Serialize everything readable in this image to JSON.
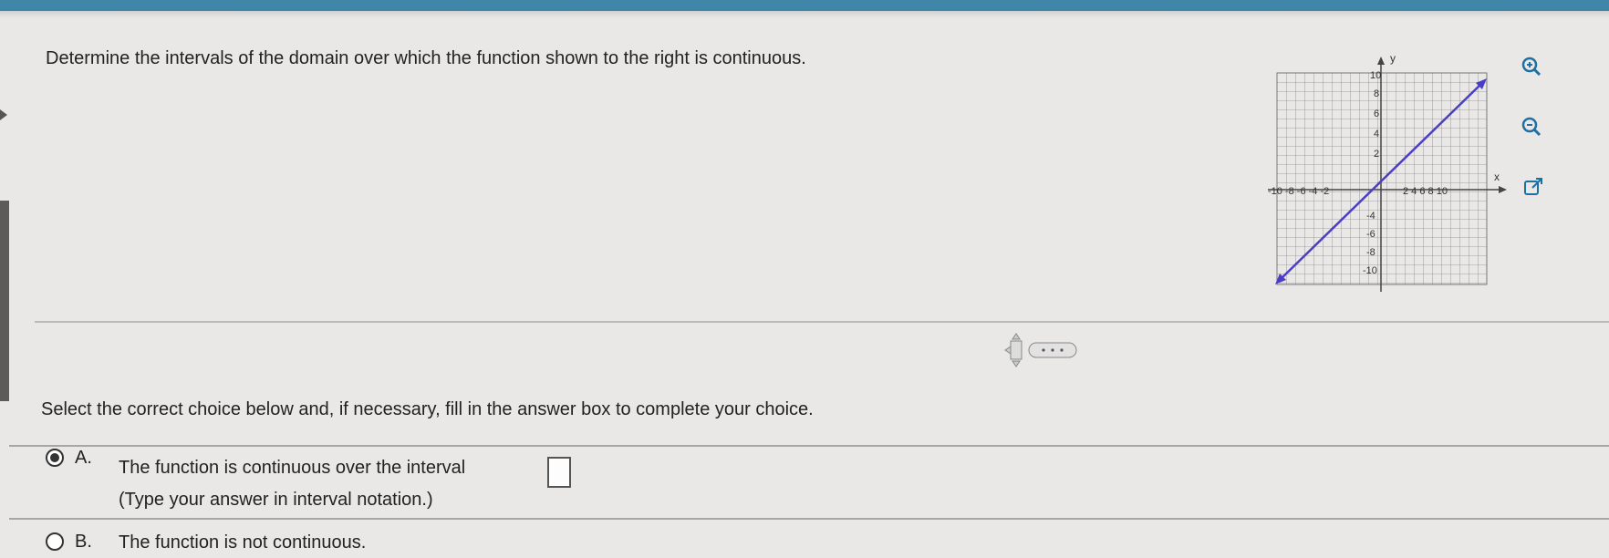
{
  "question": {
    "text": "Determine the intervals of the domain over which the function shown to the right is continuous."
  },
  "graph": {
    "y_axis_label": "y",
    "x_axis_label": "x",
    "y_ticks_positive": [
      "10",
      "8",
      "6",
      "4",
      "2"
    ],
    "y_ticks_negative": [
      "-4",
      "-6",
      "-8",
      "-10"
    ],
    "x_ticks_negative": "-10 -8 -6 -4 -2",
    "x_ticks_positive": "2 4 6 8 10",
    "line_color": "#4a3fc4",
    "buttons": [
      "zoom-in-icon",
      "zoom-out-icon",
      "external-link-icon"
    ]
  },
  "instruction": "Select the correct choice below and, if necessary, fill in the answer box to complete your choice.",
  "choices": {
    "a": {
      "letter": "A.",
      "text": "The function is continuous over the interval",
      "hint": "(Type your answer in interval notation.)",
      "selected": true
    },
    "b": {
      "letter": "B.",
      "text": "The function is not continuous.",
      "selected": false
    }
  }
}
